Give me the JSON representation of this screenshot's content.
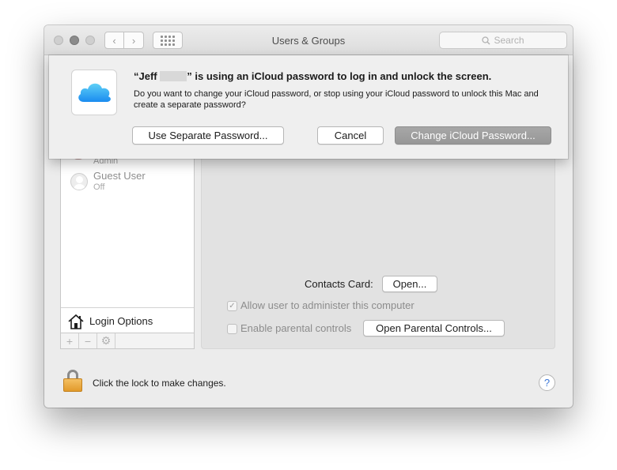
{
  "window": {
    "title": "Users & Groups",
    "search_placeholder": "Search",
    "nav_back": "‹",
    "nav_forward": "›"
  },
  "sidebar": {
    "partial_user_role": "Admin",
    "guest_user_name": "Guest User",
    "guest_user_status": "Off",
    "login_options_label": "Login Options",
    "toolbar": {
      "add": "+",
      "remove": "−",
      "settings": "⚙"
    }
  },
  "detail": {
    "contacts_card_label": "Contacts Card:",
    "contacts_open_button": "Open...",
    "allow_admin_label": "Allow user to administer this computer",
    "allow_admin_checked": true,
    "parental_controls_label": "Enable parental controls",
    "parental_controls_checked": false,
    "open_parental_button": "Open Parental Controls..."
  },
  "footer": {
    "lock_text": "Click the lock to make changes.",
    "help": "?"
  },
  "dialog": {
    "title_prefix": "“Jeff",
    "title_suffix": "” is using an iCloud password to log in and unlock the screen.",
    "message": "Do you want to change your iCloud password, or stop using your iCloud password to unlock this Mac and create a separate password?",
    "button_separate": "Use Separate Password...",
    "button_cancel": "Cancel",
    "button_change": "Change iCloud Password..."
  },
  "colors": {
    "icloud_blue_top": "#5fd0f6",
    "icloud_blue_bottom": "#1a8cf0",
    "lock_gold": "#f0b04a",
    "default_button_gray": "#9e9e9e"
  }
}
